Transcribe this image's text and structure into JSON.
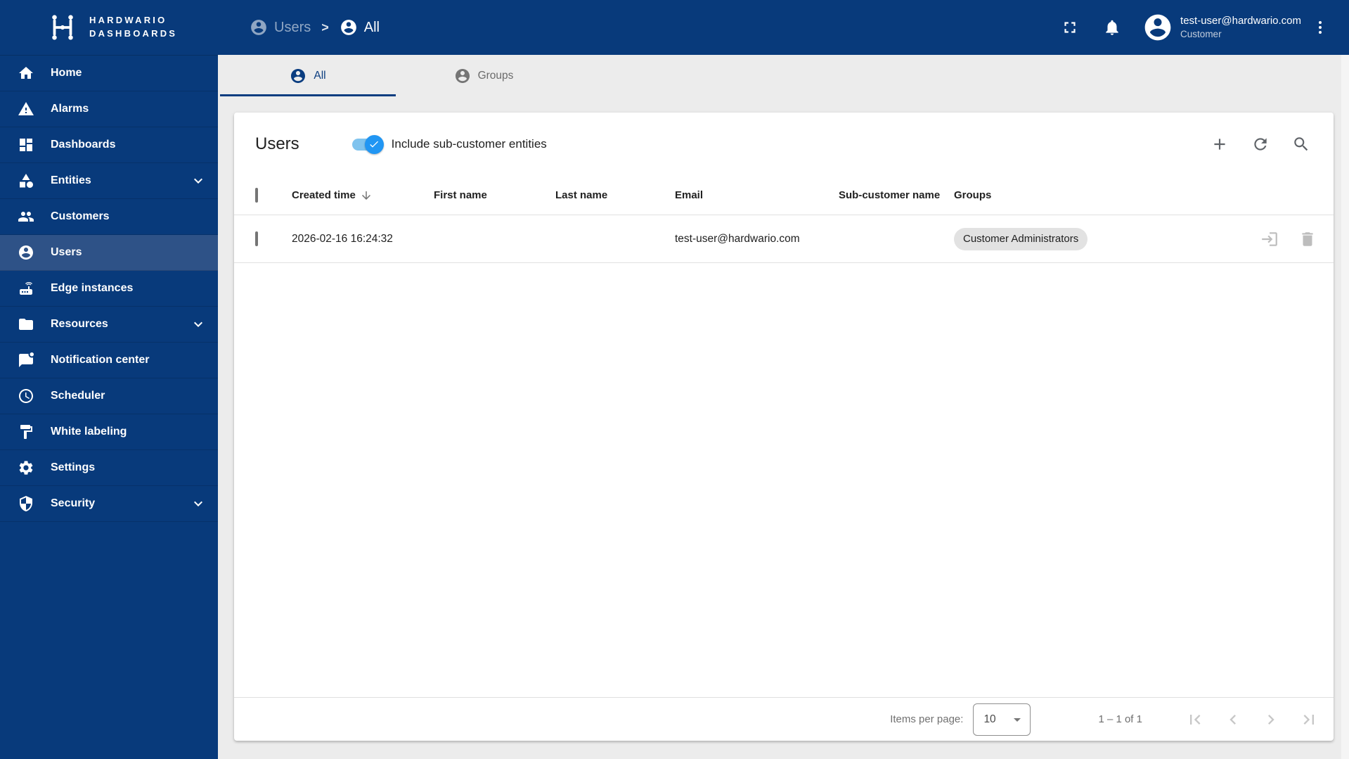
{
  "brand": {
    "line1": "HARDWARIO",
    "line2": "DASHBOARDS"
  },
  "breadcrumb": {
    "separator": ">",
    "items": [
      {
        "label": "Users",
        "icon": "account-circle-icon"
      },
      {
        "label": "All",
        "icon": "account-circle-icon"
      }
    ]
  },
  "topbar": {
    "user_email": "test-user@hardwario.com",
    "user_role": "Customer",
    "icons": [
      "fullscreen-icon",
      "bell-icon",
      "avatar-icon",
      "kebab-menu-icon"
    ]
  },
  "sidebar": {
    "items": [
      {
        "label": "Home",
        "icon": "home-icon",
        "expandable": false,
        "active": false
      },
      {
        "label": "Alarms",
        "icon": "warning-icon",
        "expandable": false,
        "active": false
      },
      {
        "label": "Dashboards",
        "icon": "dashboard-icon",
        "expandable": false,
        "active": false
      },
      {
        "label": "Entities",
        "icon": "category-icon",
        "expandable": true,
        "active": false
      },
      {
        "label": "Customers",
        "icon": "people-icon",
        "expandable": false,
        "active": false
      },
      {
        "label": "Users",
        "icon": "account-circle-icon",
        "expandable": false,
        "active": true
      },
      {
        "label": "Edge instances",
        "icon": "router-icon",
        "expandable": false,
        "active": false
      },
      {
        "label": "Resources",
        "icon": "folder-icon",
        "expandable": true,
        "active": false
      },
      {
        "label": "Notification center",
        "icon": "chat-unread-icon",
        "expandable": false,
        "active": false
      },
      {
        "label": "Scheduler",
        "icon": "clock-icon",
        "expandable": false,
        "active": false
      },
      {
        "label": "White labeling",
        "icon": "paint-roller-icon",
        "expandable": false,
        "active": false
      },
      {
        "label": "Settings",
        "icon": "gear-icon",
        "expandable": false,
        "active": false
      },
      {
        "label": "Security",
        "icon": "shield-icon",
        "expandable": true,
        "active": false
      }
    ]
  },
  "tabs": [
    {
      "label": "All",
      "icon": "account-circle-icon",
      "active": true
    },
    {
      "label": "Groups",
      "icon": "account-circle-icon",
      "active": false
    }
  ],
  "card": {
    "title": "Users",
    "toggle_label": "Include sub-customer entities",
    "toggle_on": true,
    "actions": [
      "add-icon",
      "refresh-icon",
      "search-icon"
    ]
  },
  "table": {
    "columns": [
      "Created time",
      "First name",
      "Last name",
      "Email",
      "Sub-customer name",
      "Groups"
    ],
    "sorted_column": "Created time",
    "sort_direction": "desc",
    "rows": [
      {
        "created_time": "2026-02-16 16:24:32",
        "first_name": "",
        "last_name": "",
        "email": "test-user@hardwario.com",
        "sub_customer": "",
        "groups": [
          "Customer Administrators"
        ],
        "row_actions": [
          "login-as-user-icon",
          "delete-icon"
        ]
      }
    ]
  },
  "paginator": {
    "items_per_page_label": "Items per page:",
    "page_size": "10",
    "range_label": "1 – 1 of 1",
    "nav_icons": [
      "first-page-icon",
      "prev-page-icon",
      "next-page-icon",
      "last-page-icon"
    ]
  },
  "colors": {
    "primary": "#083A7B",
    "sidebar_active": "#2E5287",
    "content_bg": "#ECECEC",
    "toggle_track": "#7FC3EE",
    "toggle_thumb": "#2196F3",
    "chip_bg": "#E2E2E2",
    "divider": "#E0E0E0",
    "muted_icon": "#BDBDBD"
  }
}
